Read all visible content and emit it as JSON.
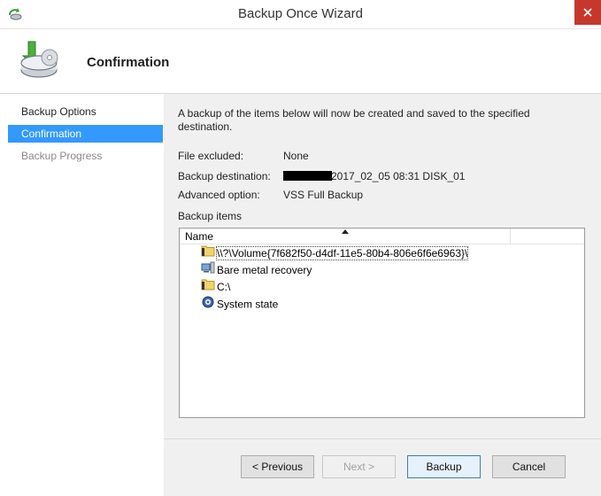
{
  "window": {
    "title": "Backup Once Wizard"
  },
  "header": {
    "page_title": "Confirmation"
  },
  "sidebar": {
    "steps": [
      {
        "label": "Backup Options",
        "state": "done"
      },
      {
        "label": "Confirmation",
        "state": "active"
      },
      {
        "label": "Backup Progress",
        "state": "pending"
      }
    ]
  },
  "content": {
    "intro": "A backup of the items below will now be created and saved to the specified destination.",
    "file_excluded_label": "File excluded:",
    "file_excluded_value": "None",
    "destination_label": "Backup destination:",
    "destination_value": "2017_02_05 08:31 DISK_01",
    "advanced_label": "Advanced option:",
    "advanced_value": "VSS Full Backup",
    "items_label": "Backup items",
    "list": {
      "column_name": "Name",
      "items": [
        {
          "label": "\\\\?\\Volume{7f682f50-d4df-11e5-80b4-806e6f6e6963}\\",
          "icon": "folder-icon"
        },
        {
          "label": "Bare metal recovery",
          "icon": "computer-icon"
        },
        {
          "label": "C:\\",
          "icon": "folder-icon"
        },
        {
          "label": "System state",
          "icon": "gear-icon"
        }
      ]
    }
  },
  "footer": {
    "previous_label": "< Previous",
    "next_label": "Next >",
    "backup_label": "Backup",
    "cancel_label": "Cancel"
  },
  "colors": {
    "accent": "#3399ff",
    "close": "#c7382c",
    "panel": "#f0f0f0"
  }
}
